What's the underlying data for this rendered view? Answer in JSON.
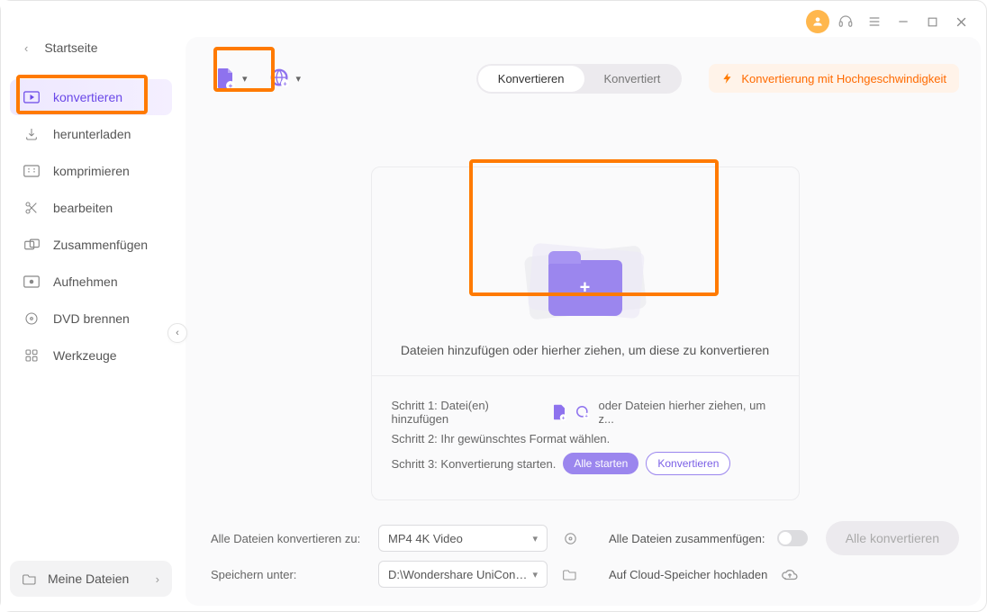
{
  "home_label": "Startseite",
  "sidebar": {
    "items": [
      {
        "label": "konvertieren"
      },
      {
        "label": "herunterladen"
      },
      {
        "label": "komprimieren"
      },
      {
        "label": "bearbeiten"
      },
      {
        "label": "Zusammenfügen"
      },
      {
        "label": "Aufnehmen"
      },
      {
        "label": "DVD brennen"
      },
      {
        "label": "Werkzeuge"
      }
    ],
    "my_files": "Meine Dateien"
  },
  "tabs": {
    "convert": "Konvertieren",
    "converted": "Konvertiert"
  },
  "speed": "Konvertierung mit Hochgeschwindigkeit",
  "drop": {
    "message": "Dateien hinzufügen oder hierher ziehen, um diese zu konvertieren",
    "step1_prefix": "Schritt 1: Datei(en) hinzufügen",
    "step1_suffix": "oder Dateien hierher ziehen, um z...",
    "step2": "Schritt 2: Ihr gewünschtes Format wählen.",
    "step3_prefix": "Schritt 3: Konvertierung starten.",
    "start_all": "Alle starten",
    "convert": "Konvertieren"
  },
  "footer": {
    "all_to_label": "Alle Dateien konvertieren zu:",
    "format": "MP4 4K Video",
    "merge_label": "Alle Dateien zusammenfügen:",
    "save_label": "Speichern unter:",
    "save_path": "D:\\Wondershare UniConverter",
    "cloud_label": "Auf Cloud-Speicher hochladen",
    "convert_all": "Alle konvertieren"
  }
}
